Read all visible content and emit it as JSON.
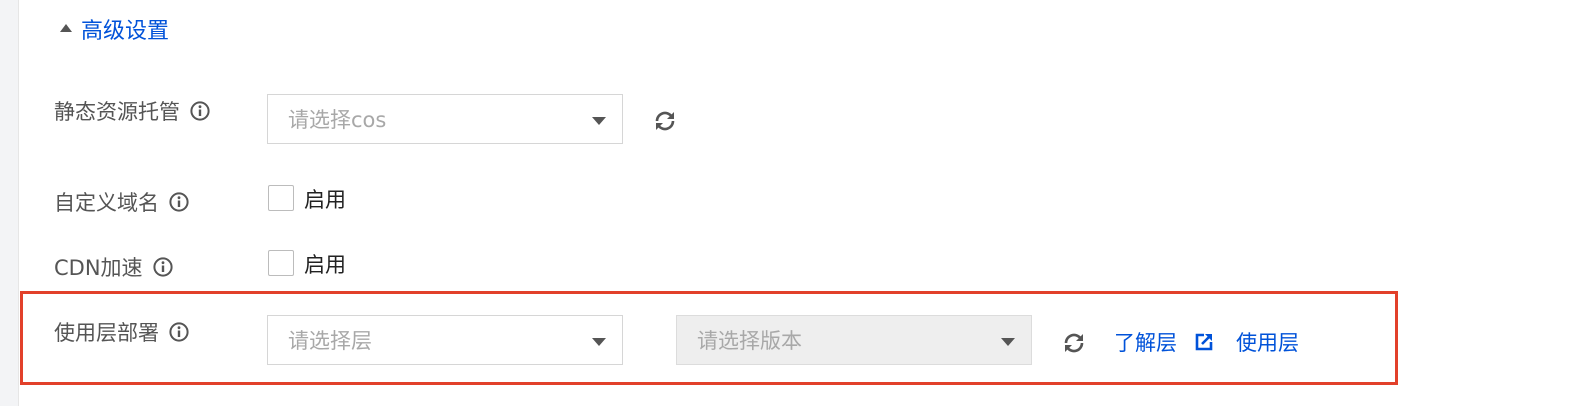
{
  "advanced": {
    "label": "高级设置",
    "expanded": true
  },
  "static_hosting": {
    "label": "静态资源托管",
    "select_placeholder": "请选择cos"
  },
  "custom_domain": {
    "label": "自定义域名",
    "checkbox_label": "启用",
    "checked": false
  },
  "cdn": {
    "label": "CDN加速",
    "checkbox_label": "启用",
    "checked": false
  },
  "layer": {
    "label": "使用层部署",
    "layer_placeholder": "请选择层",
    "version_placeholder": "请选择版本",
    "learn_link": "了解层",
    "use_link": "使用层"
  },
  "colors": {
    "link": "#0052d9",
    "highlight_border": "#e2402a",
    "text": "#555555"
  }
}
